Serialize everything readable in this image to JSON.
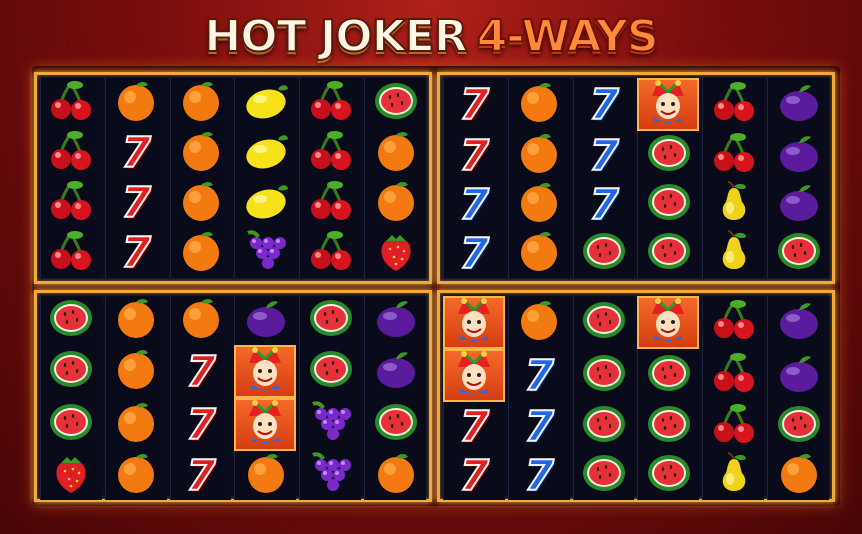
{
  "title": {
    "part1": "HOT JOKER",
    "part2": "4-WAYS"
  },
  "grids": [
    {
      "columns": [
        [
          "cherry",
          "cherry",
          "cherry",
          "cherry"
        ],
        [
          "orange",
          "seven-red",
          "seven-red",
          "seven-red"
        ],
        [
          "orange",
          "orange",
          "orange",
          "orange"
        ],
        [
          "lemon",
          "lemon",
          "lemon",
          "grapes"
        ],
        [
          "cherry",
          "cherry",
          "cherry",
          "cherry"
        ],
        [
          "watermelon",
          "orange",
          "orange",
          "strawberry"
        ]
      ]
    },
    {
      "columns": [
        [
          "seven-red",
          "seven-red",
          "seven-blue",
          "seven-blue"
        ],
        [
          "orange",
          "orange",
          "orange",
          "orange"
        ],
        [
          "seven-blue",
          "seven-blue",
          "seven-blue",
          "watermelon"
        ],
        [
          "joker",
          "watermelon",
          "watermelon",
          "watermelon"
        ],
        [
          "cherry",
          "cherry",
          "pear",
          "pear"
        ],
        [
          "plum",
          "plum",
          "plum",
          "watermelon"
        ]
      ]
    },
    {
      "columns": [
        [
          "watermelon",
          "watermelon",
          "watermelon",
          "strawberry"
        ],
        [
          "orange",
          "orange",
          "orange",
          "orange"
        ],
        [
          "orange",
          "seven-red",
          "seven-red",
          "seven-red"
        ],
        [
          "plum",
          "joker",
          "joker",
          "orange"
        ],
        [
          "watermelon",
          "watermelon",
          "grapes",
          "grapes"
        ],
        [
          "plum",
          "plum",
          "watermelon",
          "orange"
        ]
      ]
    },
    {
      "columns": [
        [
          "joker",
          "joker",
          "seven-red",
          "seven-red"
        ],
        [
          "orange",
          "seven-blue",
          "seven-blue",
          "seven-blue"
        ],
        [
          "watermelon",
          "watermelon",
          "watermelon",
          "watermelon"
        ],
        [
          "joker",
          "watermelon",
          "watermelon",
          "watermelon"
        ],
        [
          "cherry",
          "cherry",
          "cherry",
          "pear"
        ],
        [
          "plum",
          "plum",
          "watermelon",
          "orange"
        ]
      ]
    }
  ]
}
